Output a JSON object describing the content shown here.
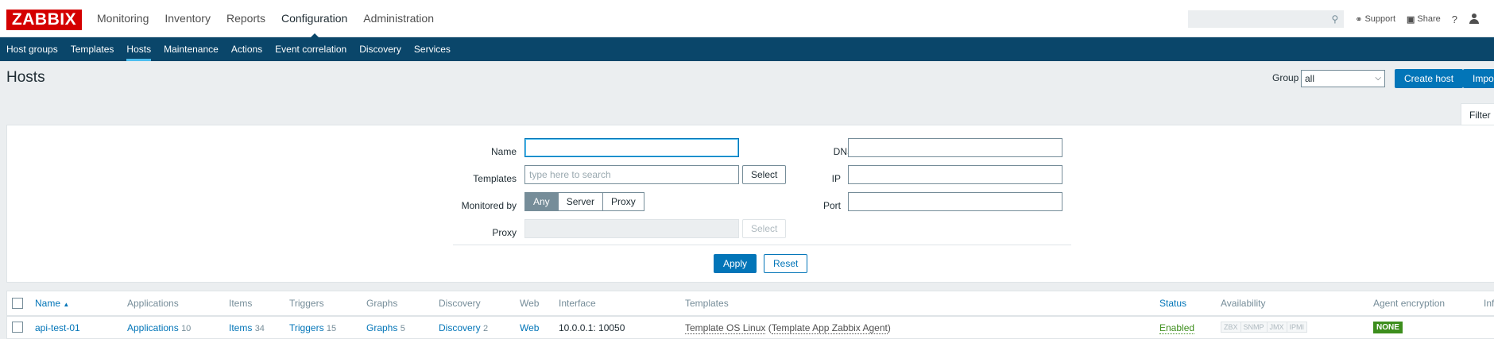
{
  "logo": "ZABBIX",
  "main_menu": [
    {
      "label": "Monitoring"
    },
    {
      "label": "Inventory"
    },
    {
      "label": "Reports"
    },
    {
      "label": "Configuration"
    },
    {
      "label": "Administration"
    }
  ],
  "top_right": {
    "search_value": "",
    "support_label": "Support",
    "share_label": "Share",
    "help_label": "?"
  },
  "sub_menu": [
    {
      "label": "Host groups"
    },
    {
      "label": "Templates"
    },
    {
      "label": "Hosts"
    },
    {
      "label": "Maintenance"
    },
    {
      "label": "Actions"
    },
    {
      "label": "Event correlation"
    },
    {
      "label": "Discovery"
    },
    {
      "label": "Services"
    }
  ],
  "page": {
    "title": "Hosts",
    "group_label": "Group",
    "group_value": "all",
    "create_button": "Create host",
    "import_button": "Import"
  },
  "filter": {
    "tab_label": "Filter",
    "name_label": "Name",
    "name_value": "",
    "templates_label": "Templates",
    "templates_placeholder": "type here to search",
    "select_label": "Select",
    "monitored_label": "Monitored by",
    "monitored_options": [
      "Any",
      "Server",
      "Proxy"
    ],
    "proxy_label": "Proxy",
    "dns_label": "DNS",
    "ip_label": "IP",
    "port_label": "Port",
    "apply_label": "Apply",
    "reset_label": "Reset"
  },
  "table": {
    "headers": {
      "name": "Name",
      "sort_indicator": "▲",
      "applications": "Applications",
      "items": "Items",
      "triggers": "Triggers",
      "graphs": "Graphs",
      "discovery": "Discovery",
      "web": "Web",
      "interface": "Interface",
      "templates": "Templates",
      "status": "Status",
      "availability": "Availability",
      "agent_encryption": "Agent encryption",
      "info": "Info"
    },
    "rows": [
      {
        "name": "api-test-01",
        "applications_label": "Applications",
        "applications_count": "10",
        "items_label": "Items",
        "items_count": "34",
        "triggers_label": "Triggers",
        "triggers_count": "15",
        "graphs_label": "Graphs",
        "graphs_count": "5",
        "discovery_label": "Discovery",
        "discovery_count": "2",
        "web_label": "Web",
        "interface": "10.0.0.1: 10050",
        "template_main": "Template OS Linux",
        "template_open": "(",
        "template_nested": "Template App Zabbix Agent",
        "template_close": ")",
        "status": "Enabled",
        "availability": [
          "ZBX",
          "SNMP",
          "JMX",
          "IPMI"
        ],
        "encryption": "NONE"
      }
    ]
  },
  "colors": {
    "brand_red": "#d40000",
    "nav_blue": "#0a466a",
    "accent": "#0275b8",
    "enabled_green": "#3d8e1d"
  }
}
